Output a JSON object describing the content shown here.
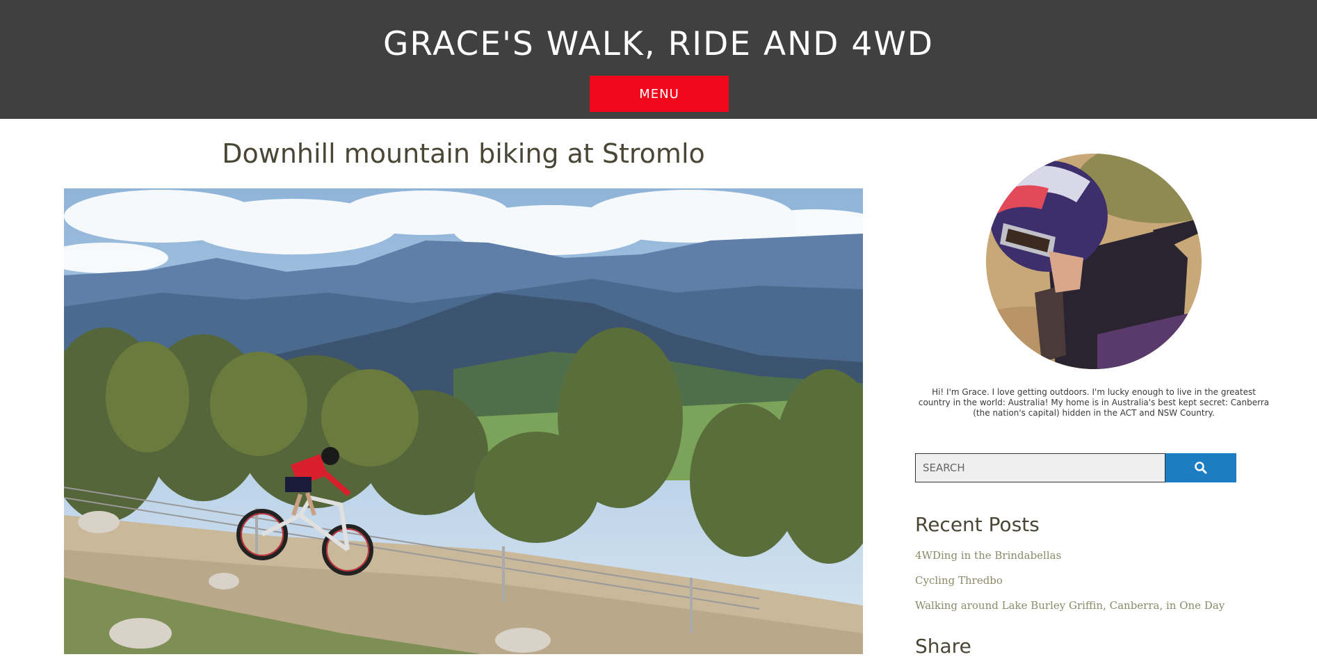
{
  "header": {
    "site_title": "GRACE'S WALK, RIDE AND 4WD",
    "menu_label": "MENU",
    "bg_color": "#404040",
    "menu_color": "#f2071b"
  },
  "post": {
    "title": "Downhill mountain biking at Stromlo",
    "image_icon": "mountain-biker-photo"
  },
  "sidebar": {
    "avatar_icon": "profile-photo-helmeted-rider",
    "bio": "Hi! I'm Grace. I love getting outdoors. I'm lucky enough to live in the greatest country in the world: Australia! My home is in Australia's best kept secret: Canberra (the nation's capital) hidden in the ACT and NSW Country.",
    "search": {
      "placeholder": "SEARCH",
      "button_icon": "search-icon",
      "button_color": "#1d7dc3"
    },
    "recent_posts_title": "Recent Posts",
    "recent_posts": [
      {
        "label": "4WDing in the Brindabellas"
      },
      {
        "label": "Cycling Thredbo"
      },
      {
        "label": "Walking around Lake Burley Griffin, Canberra, in One Day"
      }
    ],
    "share_title": "Share"
  }
}
